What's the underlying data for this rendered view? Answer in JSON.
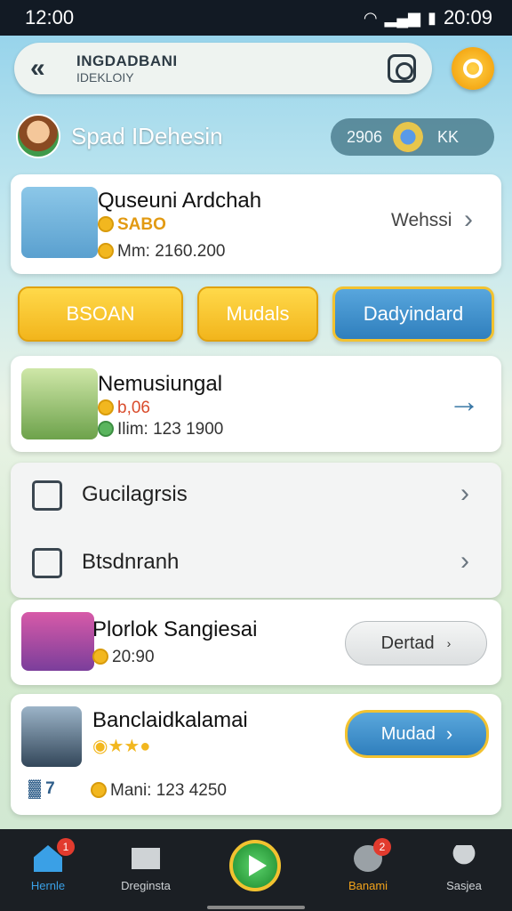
{
  "status_bar": {
    "time_left": "12:00",
    "time_right": "20:09"
  },
  "header": {
    "title": "INGDADBANI",
    "subtitle": "IDEKLOIY",
    "back_icon": "double-chevron-left-icon",
    "scan_icon": "scan-icon"
  },
  "profile": {
    "name": "Spad IDehesin",
    "currency_value": "2906",
    "currency_suffix": "KK"
  },
  "card1": {
    "title": "Quseuni Ardchah",
    "tag": "SABO",
    "line": "Mm: 2160.200",
    "link": "Wehssi"
  },
  "tabs": [
    {
      "label": "BSOAN"
    },
    {
      "label": "Mudals"
    },
    {
      "label": "Dadyindard"
    }
  ],
  "card2": {
    "title": "Nemusiungal",
    "value": "b,06",
    "line": "Ilim: 123 1900"
  },
  "list": [
    {
      "label": "Gucilagrsis"
    },
    {
      "label": "Btsdnranh"
    }
  ],
  "card3": {
    "title": "Plorlok Sangiesai",
    "line": "20:90",
    "button": "Dertad"
  },
  "card4": {
    "title": "Banclaidkalamai",
    "count": "7",
    "line": "Mani: 123 4250",
    "button": "Mudad"
  },
  "nav": [
    {
      "label": "Hernle",
      "badge": "1",
      "color": "#3aa0e6"
    },
    {
      "label": "Dreginsta",
      "color": "#cfd3d6"
    },
    {
      "label": "Banami",
      "badge": "2",
      "color": "#f2a31b"
    },
    {
      "label": "Sasjea",
      "color": "#cfd3d6"
    }
  ]
}
